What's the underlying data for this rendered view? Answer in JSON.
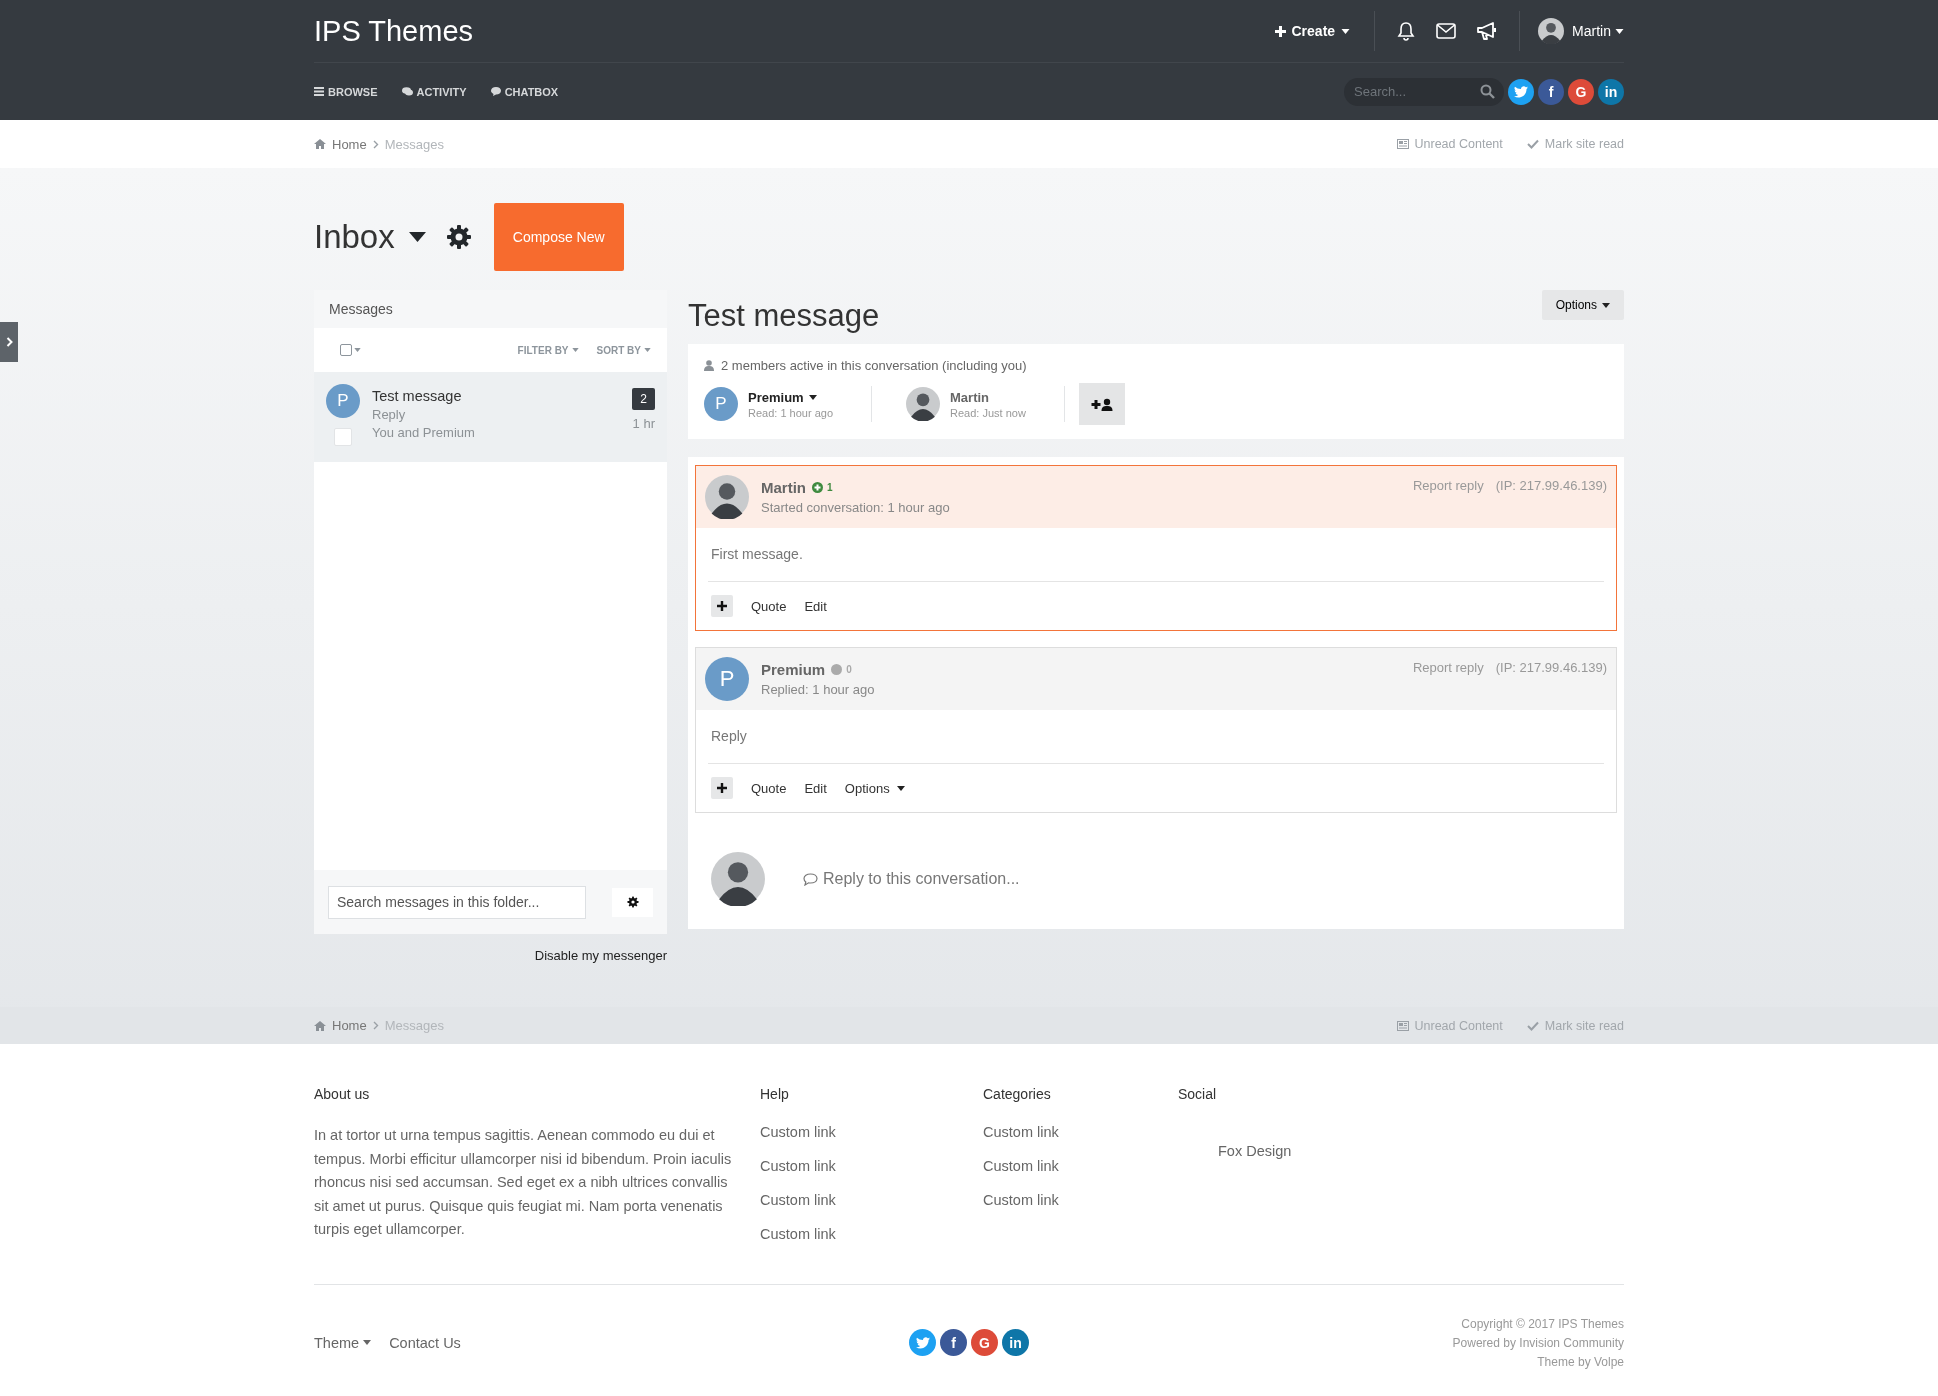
{
  "header": {
    "site_title": "IPS Themes",
    "create": "Create",
    "user": {
      "name": "Martin",
      "avatar": {
        "kind": "photo"
      }
    },
    "nav": [
      {
        "label": "BROWSE"
      },
      {
        "label": "ACTIVITY"
      },
      {
        "label": "CHATBOX"
      }
    ],
    "search": {
      "placeholder": "Search..."
    },
    "social": [
      {
        "kind": "twitter",
        "color": "#1da1f2"
      },
      {
        "kind": "facebook",
        "glyph": "f",
        "color": "#3b5998"
      },
      {
        "kind": "google",
        "glyph": "G",
        "color": "#dd4b39"
      },
      {
        "kind": "linkedin",
        "glyph": "in",
        "color": "#0e76a8"
      }
    ]
  },
  "breadcrumb": {
    "items": [
      {
        "label": "Home",
        "current": false
      },
      {
        "label": "Messages",
        "current": true
      }
    ],
    "links": [
      {
        "label": "Unread Content"
      },
      {
        "label": "Mark site read"
      }
    ]
  },
  "inbox": {
    "title": "Inbox",
    "compose": "Compose New"
  },
  "message_list": {
    "heading": "Messages",
    "select_all": {
      "checked": false
    },
    "filter": "FILTER BY",
    "sort": "SORT BY",
    "items": [
      {
        "avatar": {
          "kind": "letter",
          "letter": "P"
        },
        "title": "Test message",
        "snippet": "Reply",
        "participants": "You and Premium",
        "count": "2",
        "time": "1 hr",
        "selected": true,
        "checked": false
      }
    ],
    "search": {
      "placeholder": "Search messages in this folder..."
    },
    "disable_link": "Disable my messenger"
  },
  "conversation": {
    "title": "Test message",
    "options": "Options",
    "active_note": "2 members active in this conversation (including you)",
    "members": [
      {
        "name": "Premium",
        "read": "Read: 1 hour ago",
        "has_menu": true,
        "avatar": {
          "kind": "letter",
          "letter": "P"
        }
      },
      {
        "name": "Martin",
        "read": "Read: Just now",
        "has_menu": false,
        "avatar": {
          "kind": "photo"
        }
      }
    ],
    "posts": [
      {
        "author": "Martin",
        "avatar": {
          "kind": "photo"
        },
        "reputation": {
          "value": "1",
          "color": "#3f8a3f"
        },
        "meta": "Started conversation: 1 hour ago",
        "report": "Report reply",
        "ip": "(IP: 217.99.46.139)",
        "body": "First message.",
        "highlighted": true,
        "actions": [
          {
            "label": "Quote",
            "has_menu": false
          },
          {
            "label": "Edit",
            "has_menu": false
          }
        ]
      },
      {
        "author": "Premium",
        "avatar": {
          "kind": "letter",
          "letter": "P"
        },
        "reputation": {
          "value": "0",
          "color": "#aaaaaa"
        },
        "meta": "Replied: 1 hour ago",
        "report": "Report reply",
        "ip": "(IP: 217.99.46.139)",
        "body": "Reply",
        "highlighted": false,
        "actions": [
          {
            "label": "Quote",
            "has_menu": false
          },
          {
            "label": "Edit",
            "has_menu": false
          },
          {
            "label": "Options",
            "has_menu": true
          }
        ]
      }
    ],
    "reply_prompt": {
      "placeholder": "Reply to this conversation...",
      "avatar": {
        "kind": "photo"
      }
    }
  },
  "footer_breadcrumb": {
    "items": [
      {
        "label": "Home",
        "current": false
      },
      {
        "label": "Messages",
        "current": true
      }
    ],
    "links": [
      {
        "label": "Unread Content"
      },
      {
        "label": "Mark site read"
      }
    ]
  },
  "footer": {
    "about": {
      "title": "About us",
      "text": "In at tortor ut urna tempus sagittis. Aenean commodo eu dui et tempus. Morbi efficitur ullamcorper nisi id bibendum. Proin iaculis rhoncus nisi sed accumsan. Sed eget ex a nibh ultrices convallis sit amet ut purus. Quisque quis feugiat mi. Nam porta venenatis turpis eget ullamcorper."
    },
    "help": {
      "title": "Help",
      "links": [
        "Custom link",
        "Custom link",
        "Custom link",
        "Custom link"
      ]
    },
    "categories": {
      "title": "Categories",
      "links": [
        "Custom link",
        "Custom link",
        "Custom link"
      ]
    },
    "social": {
      "title": "Social",
      "text": "Fox Design"
    },
    "bottom_links": [
      {
        "label": "Theme",
        "has_menu": true
      },
      {
        "label": "Contact Us",
        "has_menu": false
      }
    ],
    "social_icons": [
      {
        "kind": "twitter",
        "color": "#1da1f2"
      },
      {
        "kind": "facebook",
        "glyph": "f",
        "color": "#3b5998"
      },
      {
        "kind": "google",
        "glyph": "G",
        "color": "#dd4b39"
      },
      {
        "kind": "linkedin",
        "glyph": "in",
        "color": "#0e76a8"
      }
    ],
    "copyright": [
      "Copyright © 2017 IPS Themes",
      "Powered by Invision Community",
      "Theme by Volpe"
    ]
  }
}
